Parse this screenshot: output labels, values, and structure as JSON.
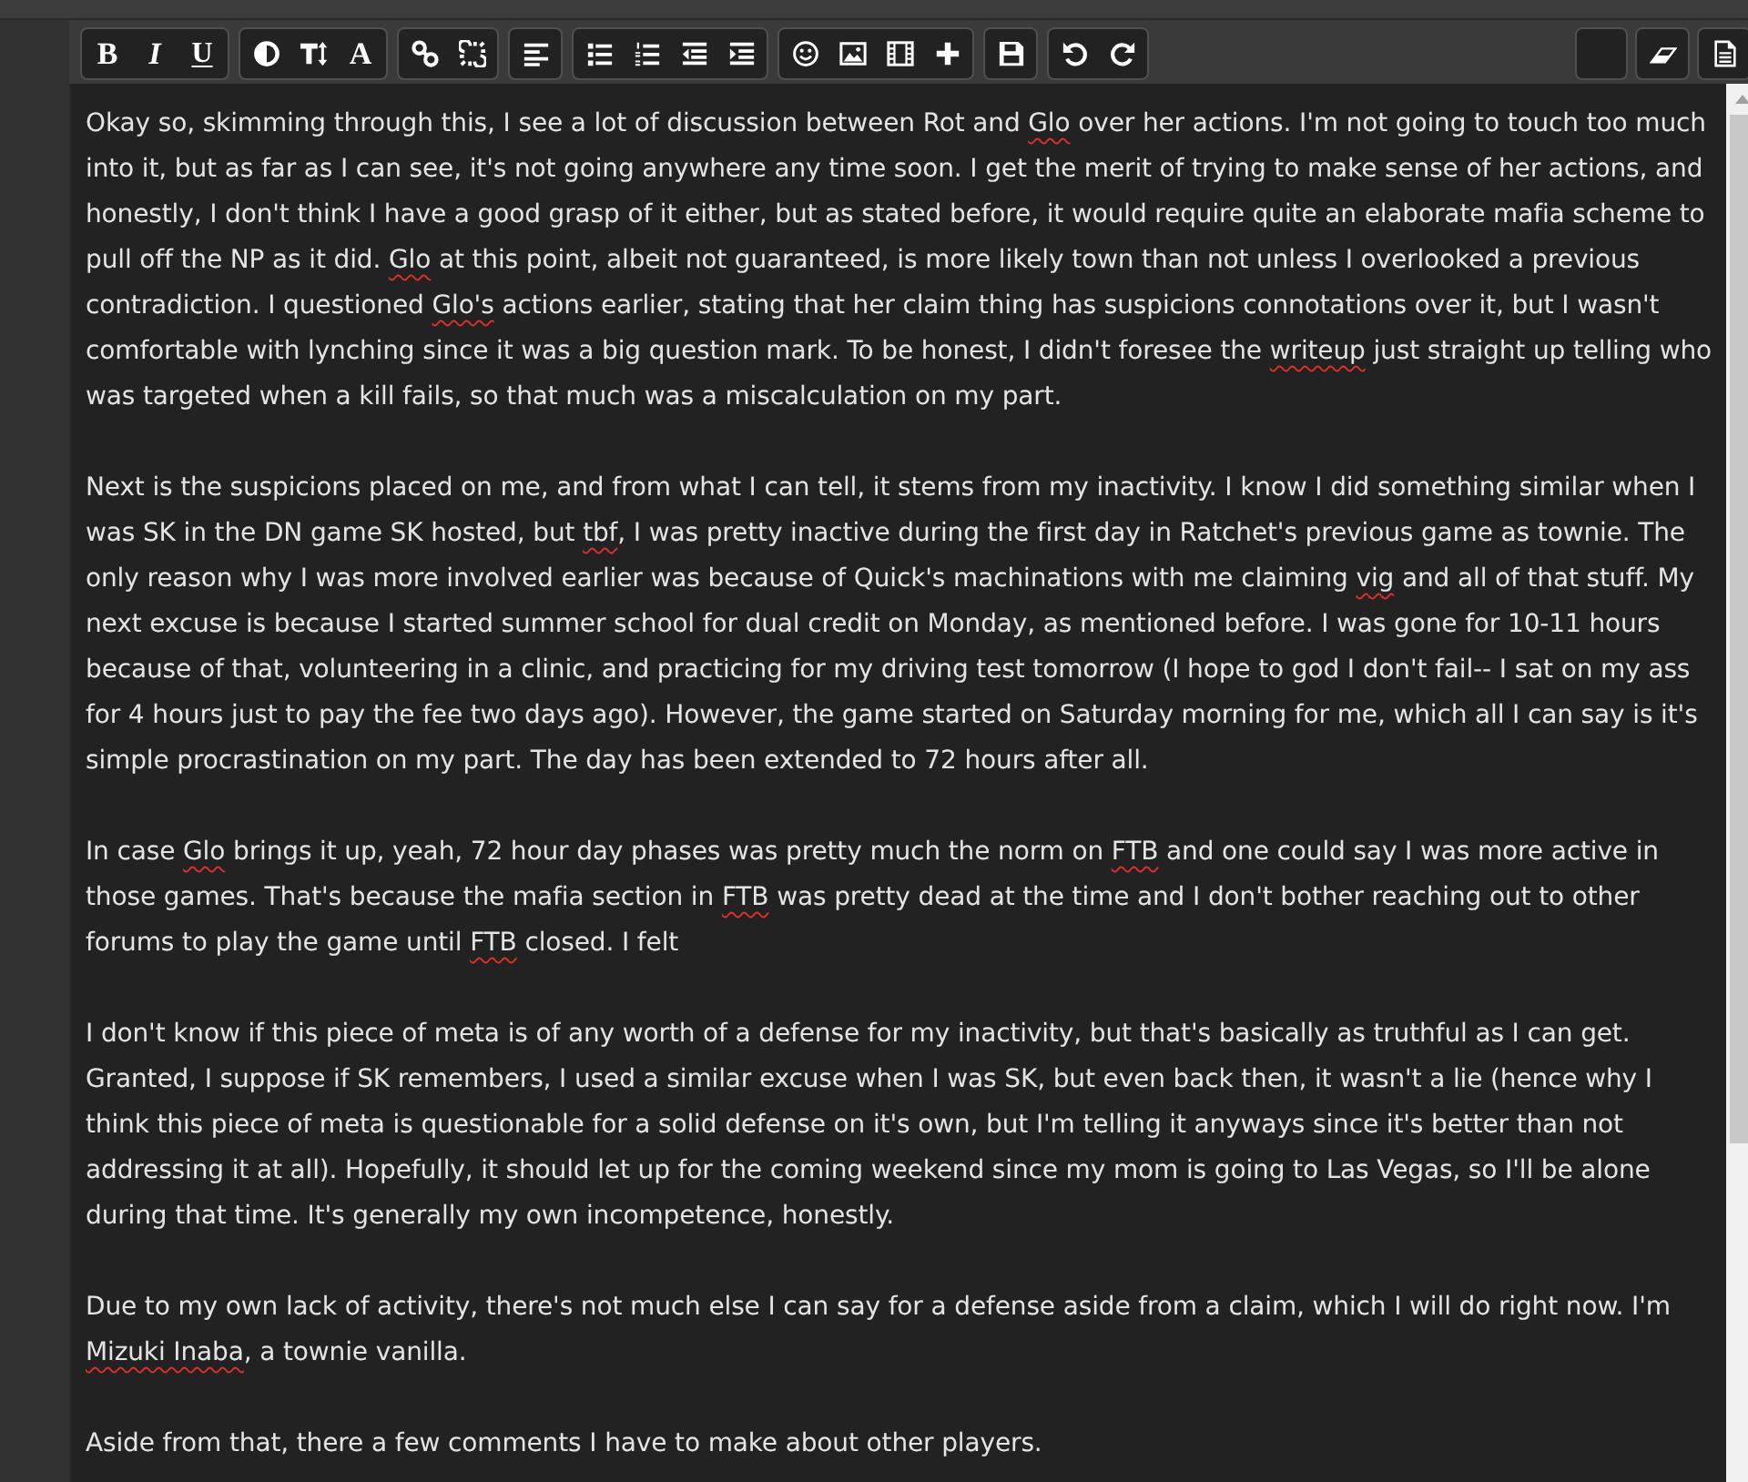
{
  "toolbar": {
    "left_groups": [
      {
        "buttons": [
          {
            "kind": "bold",
            "label": "B"
          },
          {
            "kind": "italic",
            "label": "I"
          },
          {
            "kind": "underline",
            "label": "U"
          }
        ]
      },
      {
        "buttons": [
          {
            "kind": "color"
          },
          {
            "kind": "size"
          },
          {
            "kind": "font",
            "label": "A"
          }
        ]
      },
      {
        "buttons": [
          {
            "kind": "link"
          },
          {
            "kind": "unlink"
          }
        ]
      },
      {
        "buttons": [
          {
            "kind": "align"
          }
        ]
      },
      {
        "buttons": [
          {
            "kind": "bullets"
          },
          {
            "kind": "numbers"
          },
          {
            "kind": "outdent"
          },
          {
            "kind": "indent"
          }
        ]
      },
      {
        "buttons": [
          {
            "kind": "emoji"
          },
          {
            "kind": "image"
          },
          {
            "kind": "video"
          },
          {
            "kind": "more"
          }
        ]
      },
      {
        "buttons": [
          {
            "kind": "save"
          }
        ]
      },
      {
        "buttons": [
          {
            "kind": "undo"
          },
          {
            "kind": "redo"
          }
        ]
      }
    ],
    "right_groups": [
      {
        "buttons": [
          {
            "kind": "blank"
          }
        ]
      },
      {
        "buttons": [
          {
            "kind": "eraser"
          }
        ]
      },
      {
        "buttons": [
          {
            "kind": "source"
          }
        ]
      }
    ]
  },
  "editor": {
    "paragraphs": [
      {
        "segments": [
          {
            "text": "Okay so, skimming through this, I see a lot of discussion between Rot and ",
            "misspelled": false
          },
          {
            "text": "Glo",
            "misspelled": true
          },
          {
            "text": " over her actions. I'm not going to touch too much into it, but as far as I can see, it's not going anywhere any time soon. I get the merit of trying to make sense of her actions, and honestly, I don't think I have a good grasp of it either, but as stated before, it would require quite an elaborate mafia scheme to pull off the NP as it did. ",
            "misspelled": false
          },
          {
            "text": "Glo",
            "misspelled": true
          },
          {
            "text": " at this point, albeit not guaranteed, is more likely town than not unless I overlooked a previous contradiction. I questioned ",
            "misspelled": false
          },
          {
            "text": "Glo's",
            "misspelled": true
          },
          {
            "text": " actions earlier, stating that her claim thing has suspicions connotations over it, but I wasn't comfortable with lynching since it was a big question mark. To be honest, I didn't foresee the ",
            "misspelled": false
          },
          {
            "text": "writeup",
            "misspelled": true
          },
          {
            "text": " just straight up telling who was targeted when a kill fails, so that much was a miscalculation on my part.",
            "misspelled": false
          }
        ]
      },
      {
        "segments": [
          {
            "text": "Next is the suspicions placed on me, and from what I can tell, it stems from my inactivity. I know I did something similar when I was SK in the DN game SK hosted, but ",
            "misspelled": false
          },
          {
            "text": "tbf",
            "misspelled": true
          },
          {
            "text": ", I was pretty inactive during the first day in Ratchet's previous game as townie. The only reason why I was more involved earlier was because of Quick's machinations with me claiming ",
            "misspelled": false
          },
          {
            "text": "vig",
            "misspelled": true
          },
          {
            "text": " and all of that stuff. My next excuse is because I started summer school for dual credit on Monday, as mentioned before. I was gone for 10-11 hours because of that, volunteering in a clinic, and practicing for my driving test tomorrow (I hope to god I don't fail-- I sat on my ass for 4 hours just to pay the fee two days ago). However, the game started on Saturday morning for me, which all I can say is it's simple procrastination on my part. The day has been extended to 72 hours after all.",
            "misspelled": false
          }
        ]
      },
      {
        "segments": [
          {
            "text": "In case ",
            "misspelled": false
          },
          {
            "text": "Glo",
            "misspelled": true
          },
          {
            "text": " brings it up, yeah, 72 hour day phases was pretty much the norm on ",
            "misspelled": false
          },
          {
            "text": "FTB",
            "misspelled": true
          },
          {
            "text": " and one could say I was more active in those games. That's because the mafia section in ",
            "misspelled": false
          },
          {
            "text": "FTB",
            "misspelled": true
          },
          {
            "text": " was pretty dead at the time and I don't bother reaching out to other forums to play the game until ",
            "misspelled": false
          },
          {
            "text": "FTB",
            "misspelled": true
          },
          {
            "text": " closed. I felt",
            "misspelled": false
          }
        ]
      },
      {
        "segments": [
          {
            "text": "I don't know if this piece of meta is of any worth of a defense for my inactivity, but that's basically as truthful as I can get. Granted, I suppose if SK remembers, I used a similar excuse when I was SK, but even back then, it wasn't a lie (hence why I think this piece of meta is questionable for a solid defense on it's own, but I'm telling it anyways since it's better than not addressing it at all). Hopefully, it should let up for the coming weekend since my mom is going to Las Vegas, so I'll be alone during that time. It's generally my own incompetence, honestly.",
            "misspelled": false
          }
        ]
      },
      {
        "segments": [
          {
            "text": "Due to my own lack of activity, there's not much else I can say for a defense aside from a claim, which I will do right now. I'm ",
            "misspelled": false
          },
          {
            "text": "Mizuki Inaba",
            "misspelled": true
          },
          {
            "text": ", a townie vanilla.",
            "misspelled": false
          }
        ]
      },
      {
        "segments": [
          {
            "text": "Aside from that, there a few comments I have to make about other players.",
            "misspelled": false
          }
        ]
      }
    ]
  }
}
